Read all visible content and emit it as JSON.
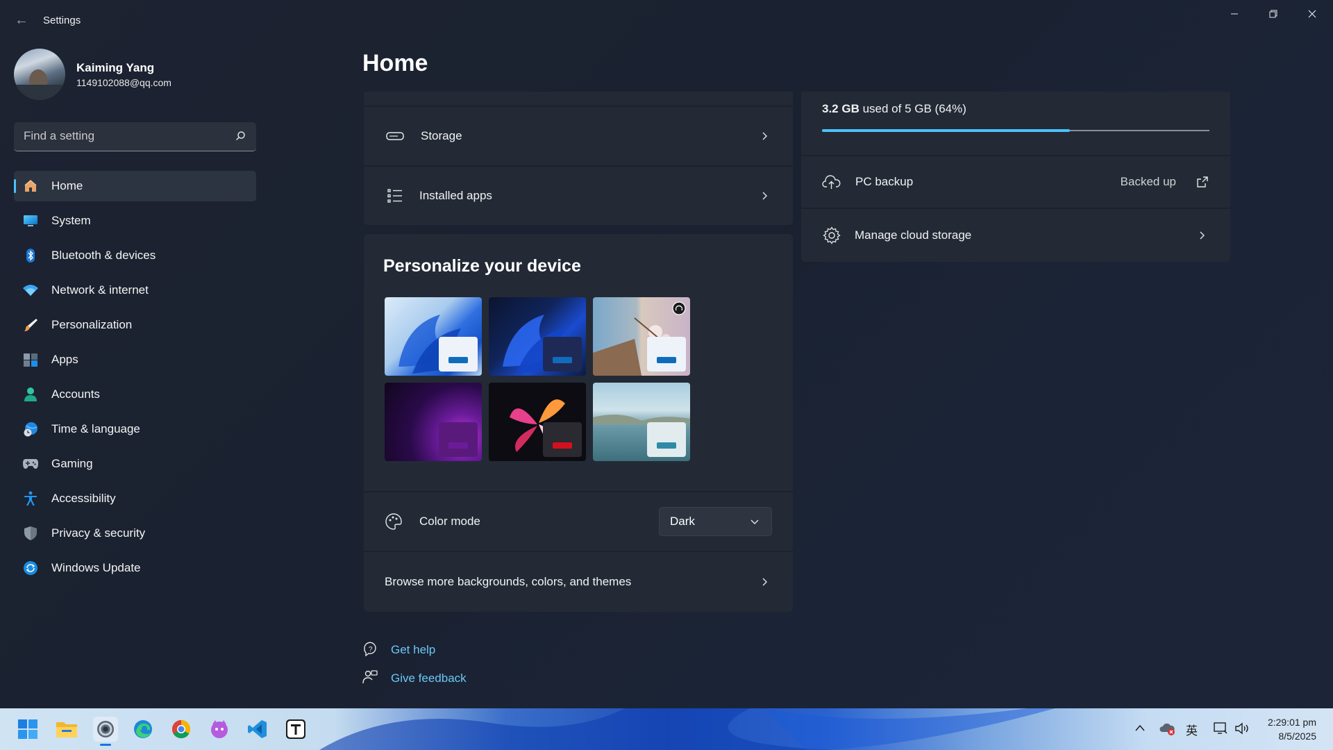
{
  "window": {
    "title": "Settings"
  },
  "profile": {
    "name": "Kaiming Yang",
    "email": "1149102088@qq.com"
  },
  "search": {
    "placeholder": "Find a setting"
  },
  "nav": {
    "items": [
      {
        "label": "Home",
        "icon": "home-icon",
        "active": true
      },
      {
        "label": "System",
        "icon": "system-icon"
      },
      {
        "label": "Bluetooth & devices",
        "icon": "bluetooth-icon"
      },
      {
        "label": "Network & internet",
        "icon": "wifi-icon"
      },
      {
        "label": "Personalization",
        "icon": "brush-icon"
      },
      {
        "label": "Apps",
        "icon": "apps-icon"
      },
      {
        "label": "Accounts",
        "icon": "account-icon"
      },
      {
        "label": "Time & language",
        "icon": "clock-globe-icon"
      },
      {
        "label": "Gaming",
        "icon": "gamepad-icon"
      },
      {
        "label": "Accessibility",
        "icon": "accessibility-icon"
      },
      {
        "label": "Privacy & security",
        "icon": "shield-icon"
      },
      {
        "label": "Windows Update",
        "icon": "update-icon"
      }
    ]
  },
  "main": {
    "title": "Home",
    "recommended": {
      "storage_label": "Storage",
      "installed_apps_label": "Installed apps"
    },
    "personalize": {
      "title": "Personalize your device",
      "themes": [
        {
          "name": "theme-light-bloom",
          "accent": "#0f6cbd"
        },
        {
          "name": "theme-dark-bloom",
          "accent": "#0f6cbd"
        },
        {
          "name": "theme-spotlight",
          "accent": "#0f6cbd",
          "spotlight": true
        },
        {
          "name": "theme-glow",
          "accent": "#6a1b9a"
        },
        {
          "name": "theme-captured-motion",
          "accent": "#d3101e"
        },
        {
          "name": "theme-flow",
          "accent": "#2f8aa6"
        }
      ],
      "color_mode_label": "Color mode",
      "color_mode_value": "Dark",
      "browse_label": "Browse more backgrounds, colors, and themes"
    },
    "cloud": {
      "usage_bold": "3.2 GB",
      "usage_rest": " used of 5 GB (64%)",
      "usage_fraction": 0.64,
      "backup_label": "PC backup",
      "backup_status": "Backed up",
      "manage_label": "Manage cloud storage"
    },
    "links": {
      "help": "Get help",
      "feedback": "Give feedback"
    }
  },
  "taskbar": {
    "apps": [
      "start-icon",
      "file-explorer-icon",
      "settings-icon",
      "edge-icon",
      "chrome-icon",
      "cat-app-icon",
      "vscode-icon",
      "typora-icon"
    ],
    "ime": "英",
    "time": "2:29:01 pm",
    "date": "8/5/2025"
  },
  "colors": {
    "accent": "#4cc2ff",
    "link": "#6cc7f5",
    "card": "#232a36"
  }
}
